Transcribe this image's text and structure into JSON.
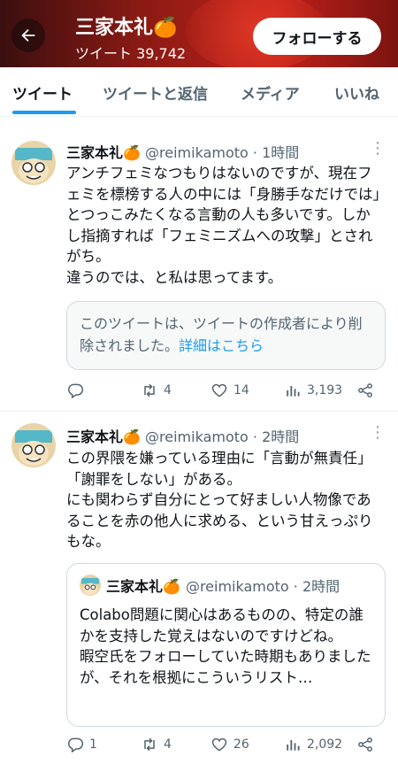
{
  "header": {
    "name": "三家本礼🍊",
    "tweet_count": "ツイート 39,742",
    "follow_label": "フォローする"
  },
  "tabs": [
    {
      "label": "ツイート",
      "active": true
    },
    {
      "label": "ツイートと返信",
      "active": false
    },
    {
      "label": "メディア",
      "active": false
    },
    {
      "label": "いいね",
      "active": false
    }
  ],
  "tweets": [
    {
      "name": "三家本礼🍊",
      "handle_time": "@reimikamoto · 1時間",
      "text": "アンチフェミなつもりはないのですが、現在フェミを標榜する人の中には「身勝手なだけでは」とつっこみたくなる言動の人も多いです。しかし指摘すれば「フェミニズムへの攻撃」とされがち。\n違うのでは、と私は思ってます。",
      "quote_text": "このツイートは、ツイートの作成者により削除されました。",
      "quote_link": "詳細はこちら",
      "replies": "",
      "retweets": "4",
      "likes": "14",
      "views": "3,193"
    },
    {
      "name": "三家本礼🍊",
      "handle_time": "@reimikamoto · 2時間",
      "text": "この界隈を嫌っている理由に「言動が無責任」「謝罪をしない」がある。\nにも関わらず自分にとって好ましい人物像であることを赤の他人に求める、という甘えっぷりもな。",
      "quote": {
        "name": "三家本礼🍊",
        "handle_time": "@reimikamoto · 2時間",
        "text": "Colabo問題に関心はあるものの、特定の誰かを支持した覚えはないのですけどね。\n暇空氏をフォローしていた時期もありましたが、それを根拠にこういうリスト…"
      },
      "replies": "1",
      "retweets": "4",
      "likes": "26",
      "views": "2,092"
    }
  ],
  "icons": [
    "back-arrow-icon",
    "more-icon",
    "reply-icon",
    "retweet-icon",
    "like-icon",
    "views-icon",
    "share-icon"
  ],
  "colors": {
    "accent": "#1d9bf0",
    "text": "#0f1419",
    "muted": "#536471",
    "header_bg": "#a01c16"
  }
}
